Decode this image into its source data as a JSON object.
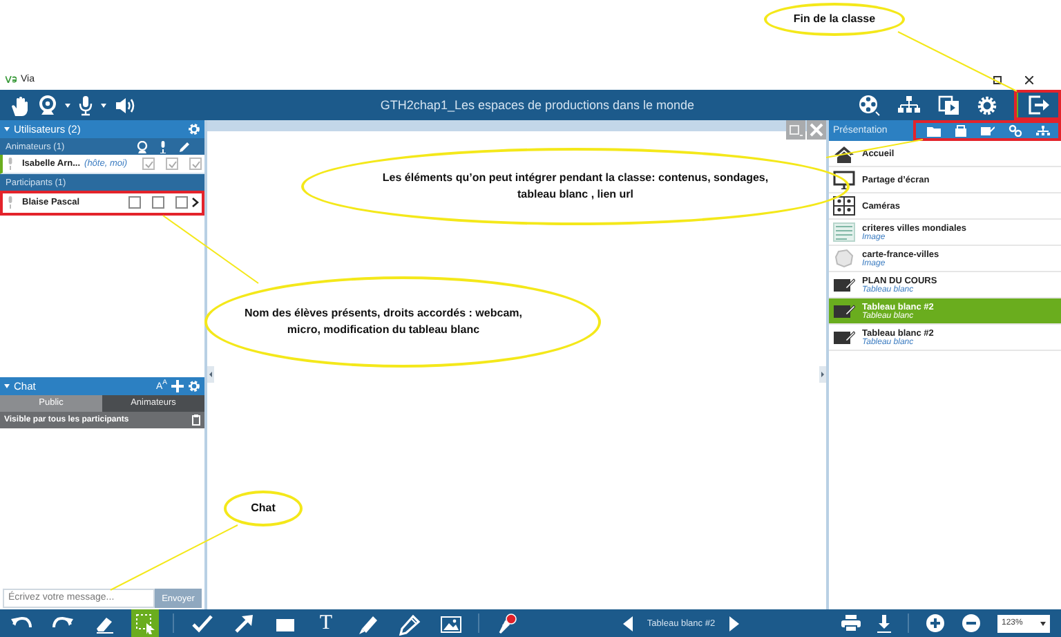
{
  "window": {
    "app_name": "Via",
    "title": "GTH2chap1_Les espaces de productions dans le monde"
  },
  "top_toolbar": {
    "exit_highlighted": true
  },
  "users_panel": {
    "title": "Utilisateurs (2)",
    "groups": [
      {
        "label": "Animateurs (1)",
        "members": [
          {
            "name": "Isabelle Arn...",
            "role": "(hôte, moi)",
            "webcam": true,
            "mic": true,
            "whiteboard": true,
            "disabled": true,
            "highlighted": false
          }
        ]
      },
      {
        "label": "Participants (1)",
        "members": [
          {
            "name": "Blaise Pascal",
            "webcam": false,
            "mic": false,
            "whiteboard": false,
            "disabled": false,
            "highlighted": true
          }
        ]
      }
    ]
  },
  "chat": {
    "title": "Chat",
    "font_button": "A$^{A}$",
    "tabs": [
      {
        "label": "Public",
        "selected": true
      },
      {
        "label": "Animateurs",
        "selected": false
      }
    ],
    "visibility": "Visible par tous les participants",
    "input": {
      "placeholder": "Écrivez votre message..."
    },
    "send_button": "Envoyer"
  },
  "presentation": {
    "title": "Présentation",
    "toolbar_highlighted": true,
    "items": [
      {
        "kind": "home",
        "title": "Accueil",
        "selected": false
      },
      {
        "kind": "screen",
        "title": "Partage d’écran",
        "selected": false
      },
      {
        "kind": "cameras",
        "title": "Caméras",
        "selected": false
      },
      {
        "kind": "document",
        "title": "criteres villes mondiales",
        "subtitle": "Image",
        "selected": false
      },
      {
        "kind": "map",
        "title": "carte-france-villes",
        "subtitle": "Image",
        "selected": false
      },
      {
        "kind": "whiteboard",
        "title": "PLAN DU COURS",
        "subtitle": "Tableau blanc",
        "selected": false
      },
      {
        "kind": "whiteboard",
        "title": "Tableau blanc #2",
        "subtitle": "Tableau blanc",
        "selected": true
      },
      {
        "kind": "whiteboard",
        "title": "Tableau blanc #2",
        "subtitle": "Tableau blanc",
        "selected": false
      }
    ]
  },
  "bottom_toolbar": {
    "tools": [
      {
        "kind": "undo",
        "selected": false
      },
      {
        "kind": "redo",
        "selected": false
      },
      {
        "kind": "eraser",
        "selected": false
      },
      {
        "kind": "select",
        "selected": true
      },
      {
        "kind": "check",
        "selected": false
      },
      {
        "kind": "arrow",
        "selected": false
      },
      {
        "kind": "rectangle",
        "selected": false
      },
      {
        "kind": "text",
        "label": "T",
        "selected": false
      },
      {
        "kind": "highlighter",
        "selected": false
      },
      {
        "kind": "pencil",
        "selected": false
      },
      {
        "kind": "image",
        "selected": false
      },
      {
        "kind": "pointer",
        "selected": false
      }
    ],
    "page_label": "Tableau blanc #2",
    "zoom": "123%"
  },
  "annotations": [
    {
      "kind": "callout",
      "text": "Fin de la classe"
    },
    {
      "kind": "callout",
      "text": "Les éléments qu’on peut intégrer pendant la classe: contenus, sondages, tableau blanc , lien url"
    },
    {
      "kind": "callout",
      "text": "Nom des élèves présents, droits accordés : webcam, micro, modification du tableau blanc"
    },
    {
      "kind": "callout",
      "text": "Chat"
    }
  ]
}
